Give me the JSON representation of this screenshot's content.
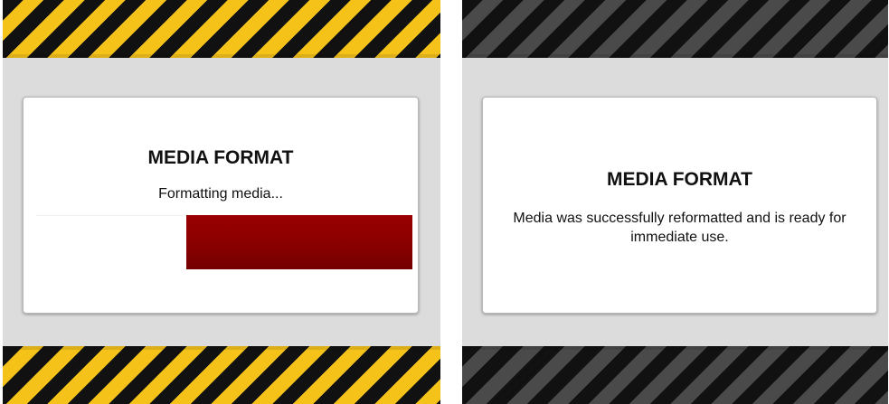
{
  "panels": [
    {
      "state": "formatting",
      "title": "MEDIA FORMAT",
      "message": "Formatting media...",
      "stripe_colors": [
        "#111111",
        "#f5c21a"
      ],
      "progress": {
        "fraction": 0.6,
        "fill_color": "#8a0000",
        "direction": "right-to-left"
      }
    },
    {
      "state": "complete",
      "title": "MEDIA FORMAT",
      "message": "Media was successfully reformatted and is ready for immediate use.",
      "stripe_colors": [
        "#111111",
        "#4a4a4a"
      ]
    }
  ]
}
